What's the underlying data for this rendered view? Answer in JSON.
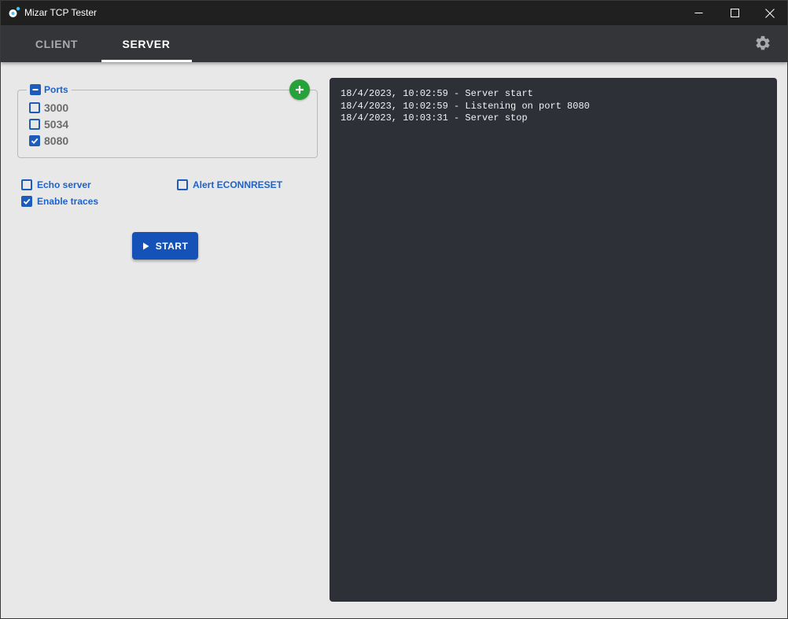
{
  "window": {
    "title": "Mizar TCP Tester",
    "icon": "app-logo-icon"
  },
  "tabs": {
    "client": "CLIENT",
    "server": "SERVER",
    "active": "SERVER"
  },
  "ports": {
    "label": "Ports",
    "header_state": "indeterminate",
    "items": [
      {
        "value": "3000",
        "checked": false
      },
      {
        "value": "5034",
        "checked": false
      },
      {
        "value": "8080",
        "checked": true
      }
    ]
  },
  "options": {
    "echo_server": {
      "label": "Echo server",
      "checked": false
    },
    "alert_econnreset": {
      "label": "Alert ECONNRESET",
      "checked": false
    },
    "enable_traces": {
      "label": "Enable traces",
      "checked": true
    }
  },
  "start_button": {
    "label": "START"
  },
  "log": {
    "lines": [
      "18/4/2023, 10:02:59 - Server start",
      "18/4/2023, 10:02:59 - Listening on port 8080",
      "18/4/2023, 10:03:31 - Server stop"
    ]
  },
  "colors": {
    "accent": "#1e5cbc",
    "start_button": "#1552b7",
    "add_button": "#27a13a",
    "tabbar": "#343538",
    "log_background": "#2e3038"
  }
}
